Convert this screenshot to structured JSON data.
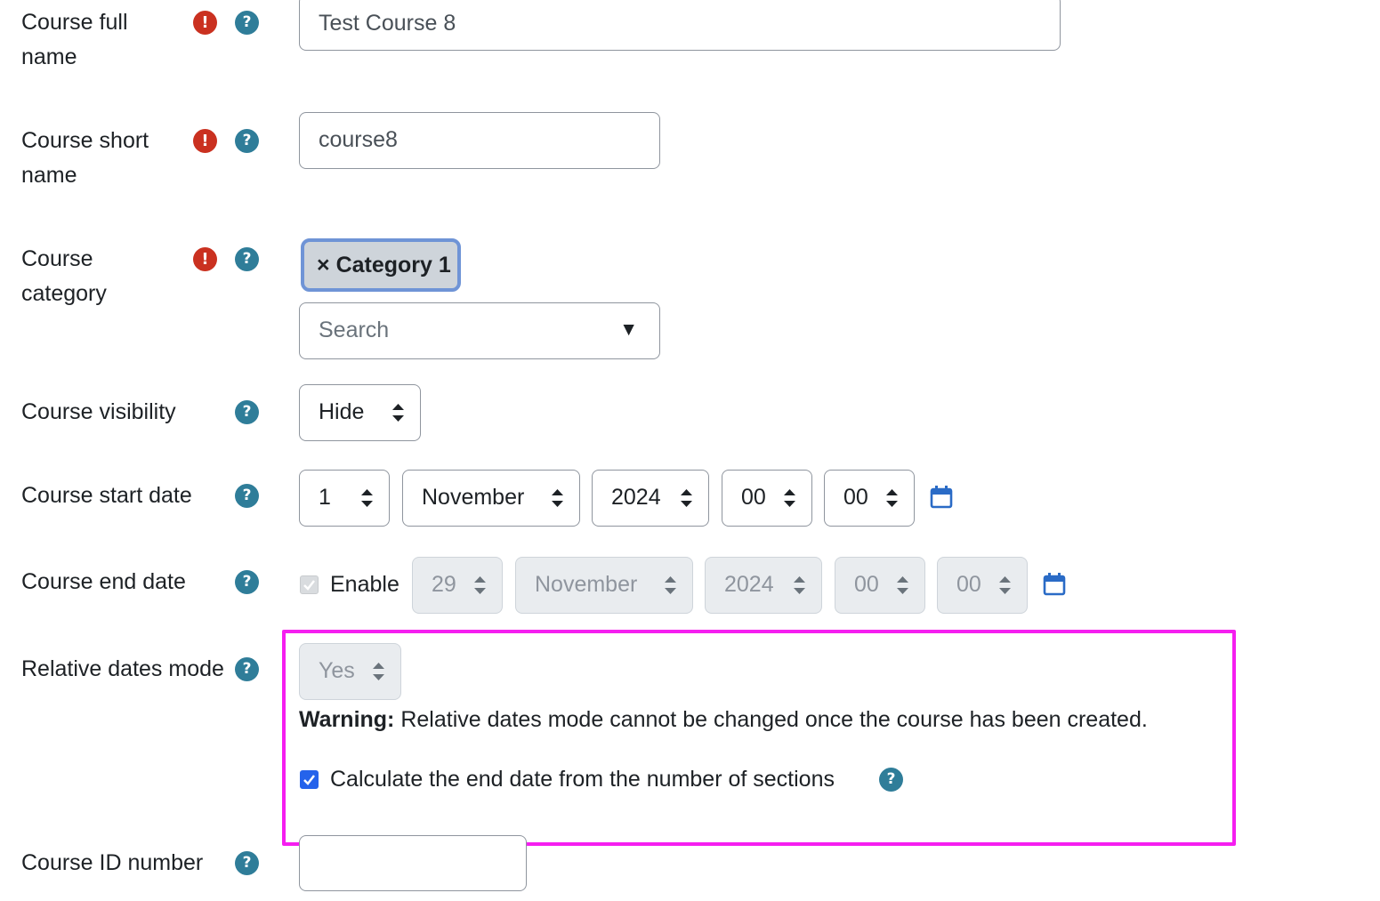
{
  "form": {
    "fullname": {
      "label": "Course full name",
      "value": "Test Course 8"
    },
    "shortname": {
      "label": "Course short name",
      "value": "course8"
    },
    "category": {
      "label": "Course category",
      "selected_tag_remove": "×",
      "selected_tag": "Category 1",
      "search_placeholder": "Search",
      "dropdown_arrow": "▼"
    },
    "visibility": {
      "label": "Course visibility",
      "value": "Hide"
    },
    "start_date": {
      "label": "Course start date",
      "day": "1",
      "month": "November",
      "year": "2024",
      "hour": "00",
      "minute": "00"
    },
    "end_date": {
      "label": "Course end date",
      "enable_label": "Enable",
      "enabled": true,
      "day": "29",
      "month": "November",
      "year": "2024",
      "hour": "00",
      "minute": "00"
    },
    "relative_dates": {
      "label": "Relative dates mode",
      "value": "Yes",
      "warning_bold": "Warning:",
      "warning_text": " Relative dates mode cannot be changed once the course has been created."
    },
    "calc_end_date": {
      "label": "Calculate the end date from the number of sections",
      "checked": true
    },
    "idnumber": {
      "label": "Course ID number",
      "value": ""
    }
  },
  "icons": {
    "required": "!",
    "help": "?"
  },
  "colors": {
    "required": "#ca3120",
    "help": "#2f7d99",
    "calendar": "#2a6bc6",
    "checkbox_checked": "#2563eb",
    "highlight": "#f51ef0"
  }
}
